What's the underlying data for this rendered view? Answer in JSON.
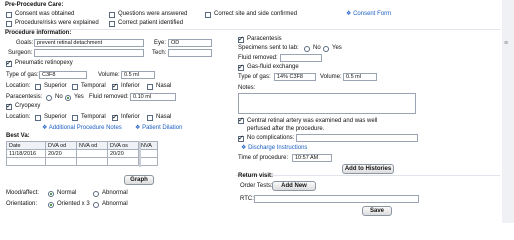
{
  "pre_care": {
    "title": "Pre-Procedure Care:",
    "items": [
      {
        "label": "Consent was obtained",
        "checked": false
      },
      {
        "label": "Questions were answered",
        "checked": false
      },
      {
        "label": "Correct site and side confirmed",
        "checked": false
      },
      {
        "label": "Procedure/risks were explained",
        "checked": false
      },
      {
        "label": "Correct patient identified",
        "checked": false
      }
    ],
    "consent_link": "Consent Form"
  },
  "proc_info": {
    "title": "Procedure information:",
    "goals_label": "Goals:",
    "goals_value": "prevent retinal detachment",
    "eye_label": "Eye:",
    "eye_value": "OD",
    "surgeon_label": "Surgeon:",
    "surgeon_value": "",
    "tech_label": "Tech:",
    "tech_value": "",
    "pneumatic_label": "Pneumatic retinopexy",
    "pneumatic_checked": true,
    "type_gas_label": "Type of gas:",
    "type_gas_value": "C3F8",
    "volume_label": "Volume:",
    "volume_value": "0.5 ml",
    "location_label": "Location:",
    "locations": [
      {
        "label": "Superior",
        "checked": false
      },
      {
        "label": "Temporal",
        "checked": false
      },
      {
        "label": "Inferior",
        "checked": true
      },
      {
        "label": "Nasal",
        "checked": false
      }
    ],
    "paracentesis_label": "Paracentesis:",
    "no_label": "No",
    "yes_label": "Yes",
    "fluid_removed_label": "Fluid removed:",
    "fluid_removed_value": "0.10 ml",
    "cryopexy_label": "Cryopexy",
    "cryopexy_checked": true,
    "cryo_locations": [
      {
        "label": "Superior",
        "checked": false
      },
      {
        "label": "Temporal",
        "checked": false
      },
      {
        "label": "Inferior",
        "checked": true
      },
      {
        "label": "Nasal",
        "checked": false
      }
    ],
    "additional_notes_link": "Additional Procedure Notes",
    "patient_dilation_link": "Patient Dilation"
  },
  "best_va": {
    "title": "Best Va:",
    "headers": [
      "Date",
      "DVA od",
      "NVA od",
      "DVA os",
      "NVA"
    ],
    "rows": [
      [
        "11/18/2016",
        "20/20",
        "",
        "20/20",
        ""
      ]
    ],
    "graph_button": "Graph"
  },
  "mood": {
    "label": "Mood/affect:",
    "options": [
      "Normal",
      "Abnormal"
    ],
    "selected": 0
  },
  "orientation": {
    "label": "Orientation:",
    "options": [
      "Oriented x 3",
      "Abnormal"
    ],
    "selected": 0
  },
  "right": {
    "paracentesis_label": "Paracentesis",
    "paracentesis_checked": true,
    "specimens_label": "Specimens sent to lab:",
    "no_label": "No",
    "yes_label": "Yes",
    "fluid_removed_label": "Fluid removed:",
    "fluid_removed_value": "",
    "gas_fluid_label": "Gas-fluid exchange",
    "gas_fluid_checked": true,
    "type_gas_label": "Type of gas:",
    "type_gas_value": "14% C3F8",
    "volume_label": "Volume:",
    "volume_value": "0.5 ml",
    "notes_label": "Notes:",
    "notes_value": "",
    "central_artery_label": "Central retinal artery was examined and was well perfused after the procedure.",
    "central_artery_checked": true,
    "no_complications_label": "No complications:",
    "no_complications_checked": true,
    "discharge_link": "Discharge Instructions",
    "time_label": "Time of procedure:",
    "time_value": "10:57 AM",
    "add_histories_button": "Add to Histories",
    "return_visit_label": "Return visit:",
    "order_tests_label": "Order Tests:",
    "add_new_button": "Add New",
    "rtc_label": "RTC:",
    "rtc_value": "",
    "save_button": "Save"
  }
}
